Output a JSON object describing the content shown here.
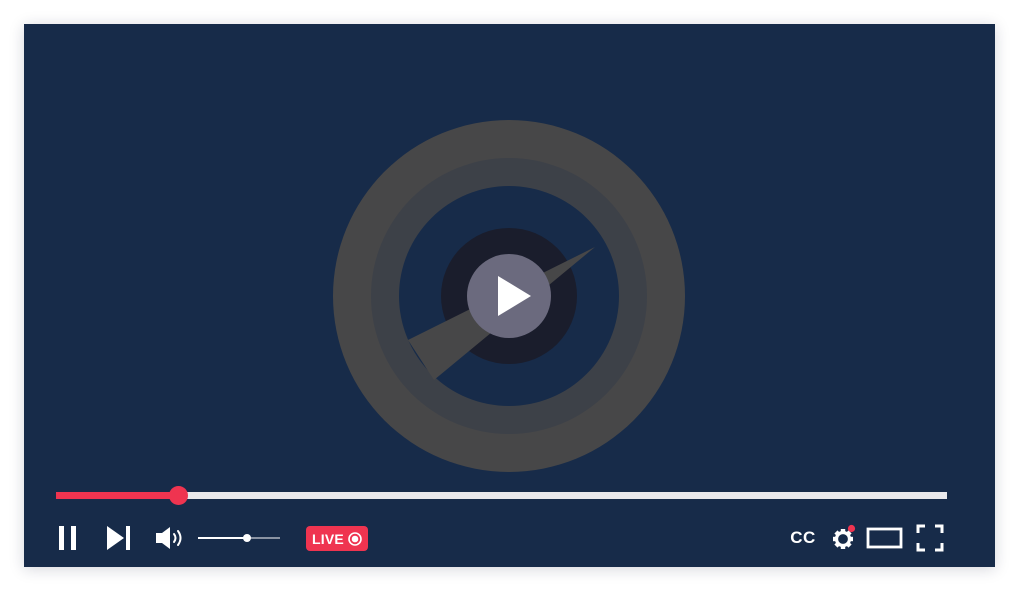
{
  "player": {
    "colors": {
      "background": "#172b49",
      "accent": "#ef3450",
      "overlay_ring": "#474748",
      "overlay_ring_inner": "#3d4148",
      "play_button_bg": "#6b6a7e",
      "play_button_halo": "#1a1d2c"
    },
    "progress": {
      "played_fraction": 0.137
    },
    "volume": {
      "level_fraction": 0.6
    },
    "live_badge": {
      "label": "LIVE"
    },
    "captions": {
      "label": "CC"
    },
    "settings": {
      "has_notification": true
    },
    "icons": {
      "pause": "pause-icon",
      "next": "skip-next-icon",
      "volume": "volume-icon",
      "live_dot": "record-dot-icon",
      "settings": "gear-icon",
      "theater": "theater-mode-icon",
      "fullscreen": "fullscreen-icon",
      "center_play": "play-icon"
    }
  }
}
